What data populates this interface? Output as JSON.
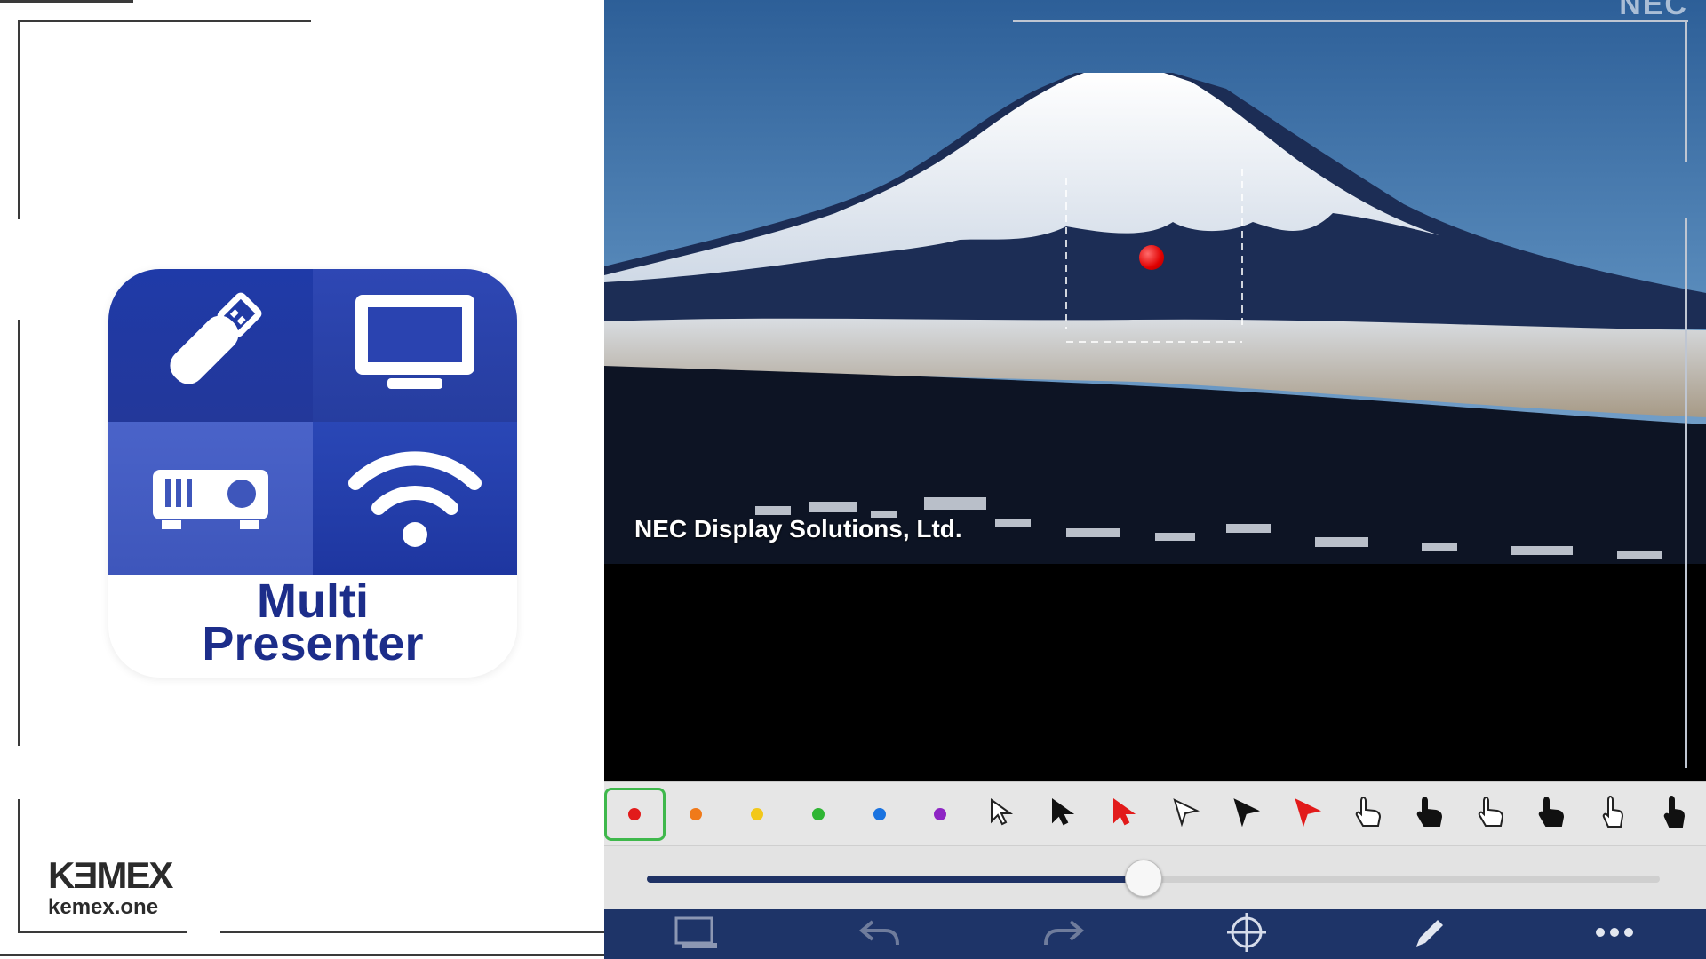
{
  "app": {
    "name_line1": "Multi",
    "name_line2": "Presenter"
  },
  "brand": {
    "logo_text": "KƎMEX",
    "url": "kemex.one"
  },
  "screen": {
    "photo_caption": "NEC Display Solutions, Ltd.",
    "watermark": "NEC"
  },
  "pointer_bar": {
    "items": [
      {
        "name": "red-dot",
        "kind": "dot",
        "color": "#e21b1b",
        "selected": true
      },
      {
        "name": "orange-dot",
        "kind": "dot",
        "color": "#f07a1a"
      },
      {
        "name": "yellow-dot",
        "kind": "dot",
        "color": "#f2c81a"
      },
      {
        "name": "green-dot",
        "kind": "dot",
        "color": "#2fb534"
      },
      {
        "name": "blue-dot",
        "kind": "dot",
        "color": "#1a73e0"
      },
      {
        "name": "purple-dot",
        "kind": "dot",
        "color": "#8e25c4"
      },
      {
        "name": "arrow-white-icon",
        "kind": "arrow",
        "color": "#ffffff"
      },
      {
        "name": "arrow-black-icon",
        "kind": "arrow",
        "color": "#111111"
      },
      {
        "name": "arrow-red-icon",
        "kind": "arrow",
        "color": "#e21b1b"
      },
      {
        "name": "triangle-white-icon",
        "kind": "tri",
        "color": "#ffffff"
      },
      {
        "name": "triangle-black-icon",
        "kind": "tri",
        "color": "#111111"
      },
      {
        "name": "triangle-red-icon",
        "kind": "tri",
        "color": "#e21b1b"
      },
      {
        "name": "hand-point-white-icon",
        "kind": "hand",
        "color": "#ffffff"
      },
      {
        "name": "hand-point-black-icon",
        "kind": "hand",
        "color": "#111111"
      },
      {
        "name": "hand-open-white-icon",
        "kind": "hand",
        "color": "#ffffff"
      },
      {
        "name": "hand-open-black-icon",
        "kind": "hand",
        "color": "#111111"
      },
      {
        "name": "finger-white-icon",
        "kind": "finger",
        "color": "#ffffff"
      },
      {
        "name": "finger-black-icon",
        "kind": "finger",
        "color": "#111111"
      }
    ]
  },
  "slider": {
    "value": 0.49
  },
  "nav_bar": {
    "buttons": [
      {
        "name": "screen-select-icon"
      },
      {
        "name": "undo-icon"
      },
      {
        "name": "redo-icon"
      },
      {
        "name": "pointer-target-icon"
      },
      {
        "name": "pen-icon"
      },
      {
        "name": "more-icon"
      }
    ]
  },
  "colors": {
    "icon_blue": "#23389a",
    "app_text": "#1c2d8a",
    "nav_bar": "#1e3468",
    "selection": "#3fb84c"
  }
}
